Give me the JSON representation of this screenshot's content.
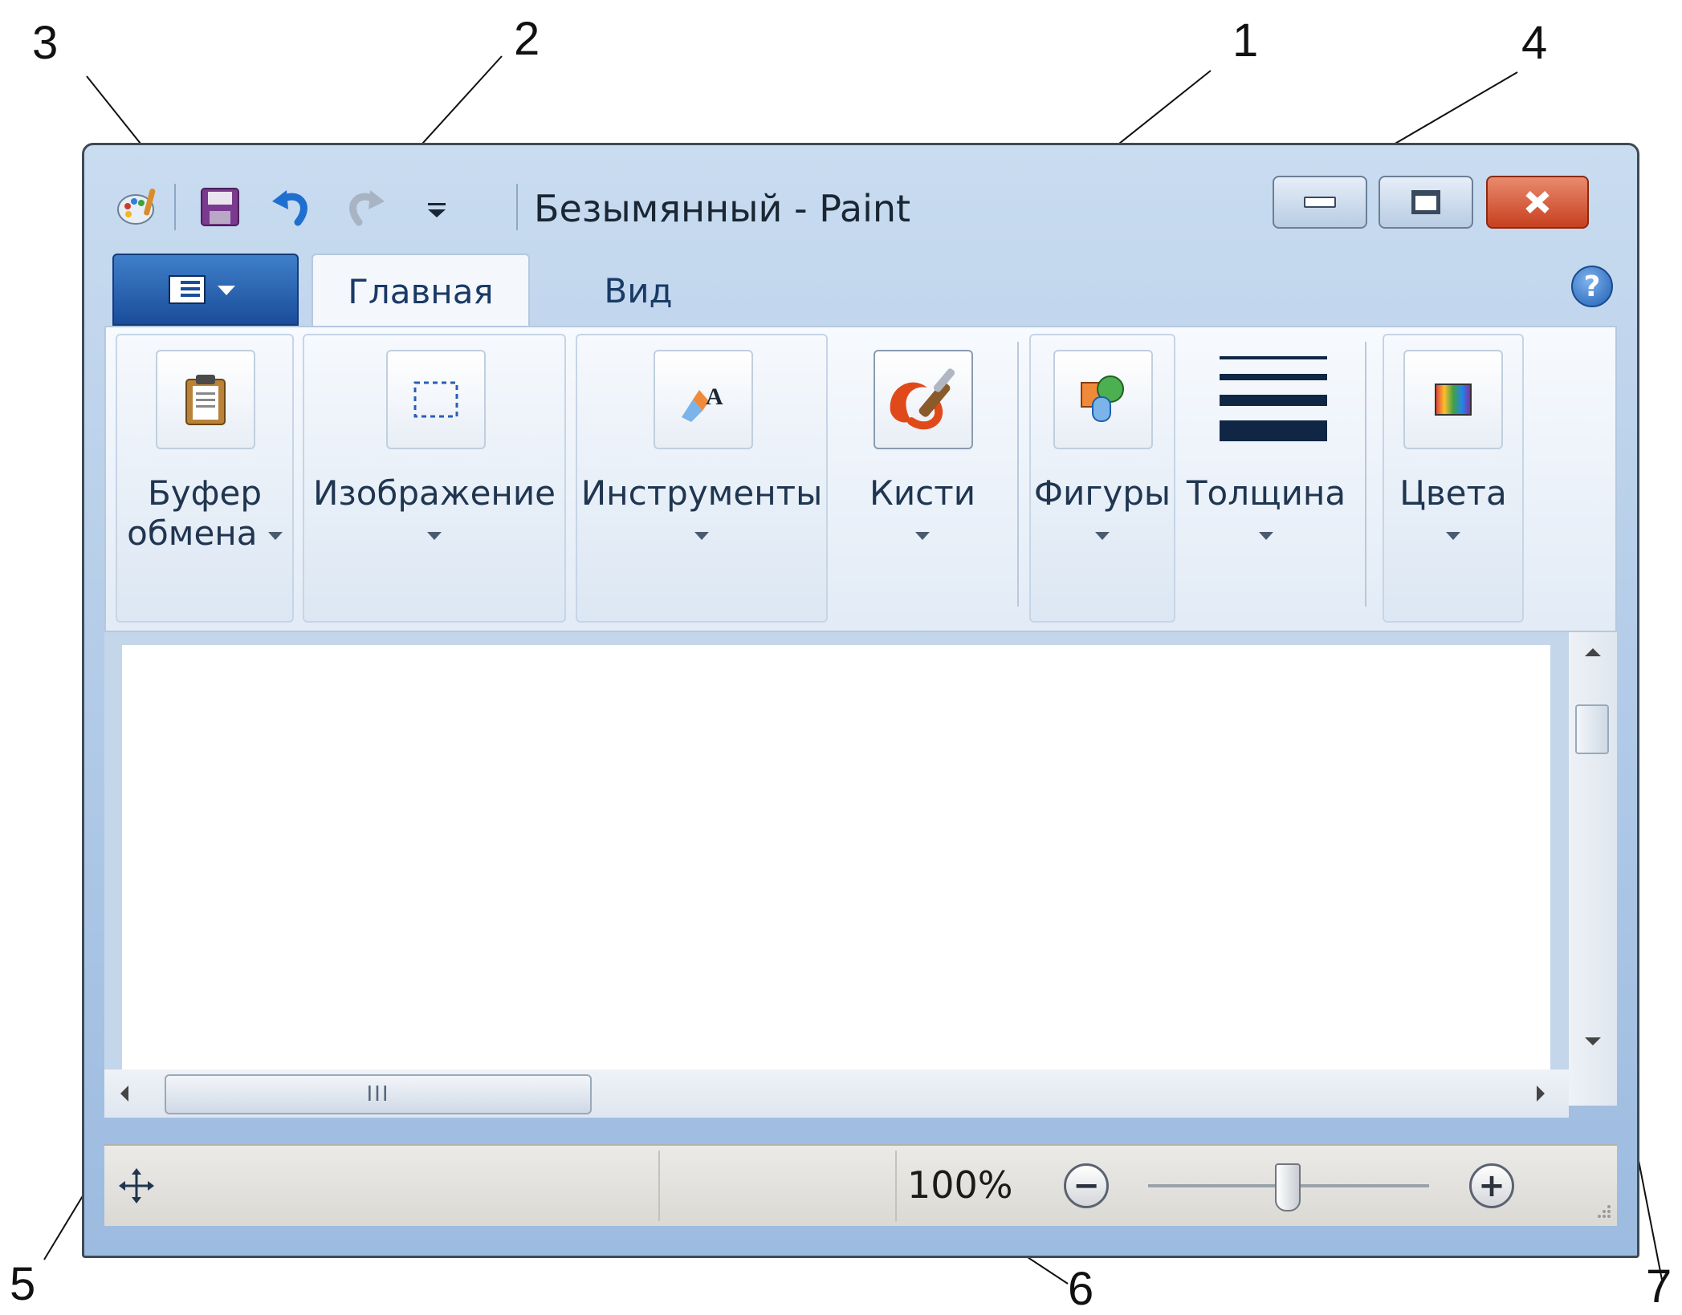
{
  "callouts": [
    "1",
    "2",
    "3",
    "4",
    "5",
    "6",
    "7"
  ],
  "window": {
    "title": "Безымянный - Paint",
    "app_icon": "paint-palette-icon",
    "quick_access": [
      "save-icon",
      "undo-icon",
      "redo-icon",
      "customize-qat-icon"
    ],
    "controls": [
      "minimize-icon",
      "maximize-icon",
      "close-icon"
    ]
  },
  "ribbon": {
    "app_menu_icon": "application-menu-icon",
    "tabs": [
      {
        "label": "Главная",
        "active": true
      },
      {
        "label": "Вид",
        "active": false
      }
    ],
    "help_icon": "help-icon",
    "help_glyph": "?",
    "groups": [
      {
        "label_line1": "Буфер",
        "label_line2": "обмена",
        "icon": "clipboard-icon"
      },
      {
        "label_line1": "Изображение",
        "label_line2": "",
        "icon": "select-rectangle-icon"
      },
      {
        "label_line1": "Инструменты",
        "label_line2": "",
        "icon": "tools-icon"
      },
      {
        "label_line1": "Кисти",
        "label_line2": "",
        "icon": "brush-icon"
      },
      {
        "label_line1": "Фигуры",
        "label_line2": "",
        "icon": "shapes-icon"
      },
      {
        "label_line1": "Толщина",
        "label_line2": "",
        "icon": "line-thickness-icon"
      },
      {
        "label_line1": "Цвета",
        "label_line2": "",
        "icon": "colors-icon"
      }
    ]
  },
  "scrollbar": {
    "thumb_glyph": "III"
  },
  "status": {
    "cursor_icon": "move-cursor-icon",
    "zoom_label": "100%",
    "zoom_out_glyph": "−",
    "zoom_in_glyph": "+",
    "zoom_percent": 100
  },
  "colors": {
    "close_button": "#c7401f",
    "app_button": "#1a4d9a",
    "ribbon_bg": "#e2ebf6"
  }
}
